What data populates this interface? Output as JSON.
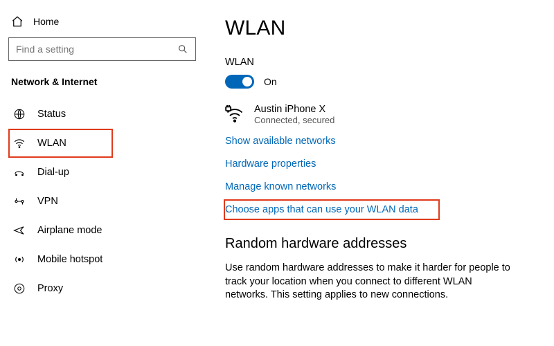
{
  "sidebar": {
    "home_label": "Home",
    "search_placeholder": "Find a setting",
    "category_title": "Network & Internet",
    "items": [
      {
        "label": "Status",
        "icon": "globe-icon"
      },
      {
        "label": "WLAN",
        "icon": "wifi-icon",
        "selected": true
      },
      {
        "label": "Dial-up",
        "icon": "dialup-icon"
      },
      {
        "label": "VPN",
        "icon": "vpn-icon"
      },
      {
        "label": "Airplane mode",
        "icon": "airplane-icon"
      },
      {
        "label": "Mobile hotspot",
        "icon": "hotspot-icon"
      },
      {
        "label": "Proxy",
        "icon": "proxy-icon"
      }
    ]
  },
  "main": {
    "title": "WLAN",
    "toggle_label": "WLAN",
    "toggle_state_label": "On",
    "toggle_on": true,
    "connection": {
      "name": "Austin iPhone X",
      "status": "Connected, secured"
    },
    "links": {
      "show_networks": "Show available networks",
      "hardware_props": "Hardware properties",
      "manage_known": "Manage known networks",
      "choose_apps": "Choose apps that can use your WLAN data"
    },
    "random": {
      "heading": "Random hardware addresses",
      "body": "Use random hardware addresses to make it harder for people to track your location when you connect to different WLAN networks. This setting applies to new connections."
    }
  }
}
